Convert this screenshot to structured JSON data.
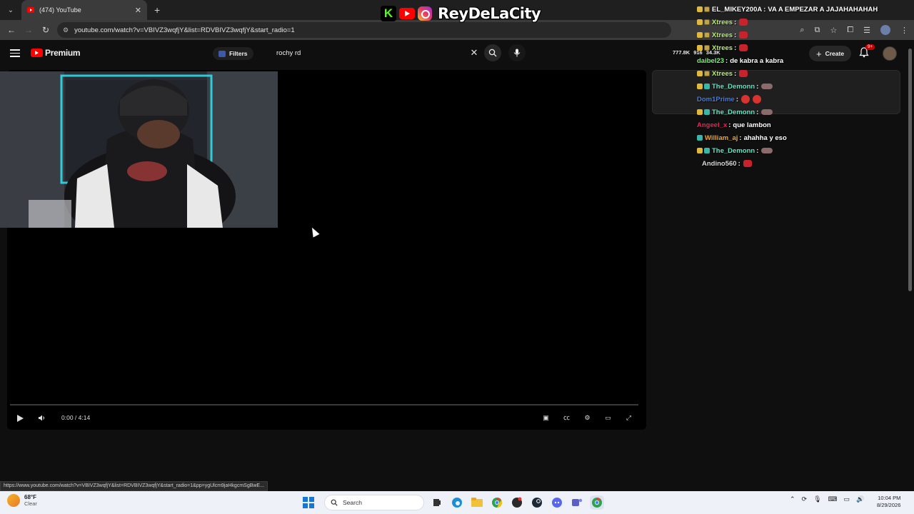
{
  "browser": {
    "tab_title": "(474) YouTube",
    "url": "youtube.com/watch?v=VBIVZ3wqfjY&list=RDVBIVZ3wqfjY&start_radio=1",
    "status_url": "https://www.youtube.com/watch?v=VBIVZ3wqfjY&list=RDVBIVZ3wqfjY&start_radio=1&pp=ygUlcm9jaHkgcmSgBwE..."
  },
  "overlay": {
    "streamer_name": "ReyDeLaCity",
    "colors": {
      "kick": "#53fc18",
      "youtube": "#ff0000"
    }
  },
  "youtube": {
    "logo_text": "Premium",
    "filters_label": "Filters",
    "search_value": "rochy rd",
    "stats": [
      "777.8K",
      "916",
      "34.3K"
    ],
    "create_label": "Create",
    "notif_badge": "9+"
  },
  "player": {
    "time": "0:00 / 4:14"
  },
  "chat": [
    {
      "user": "EL_MIKEY200A",
      "color": "#ffffff",
      "badges": [
        "crown",
        "sub"
      ],
      "text": "VA A EMPEZAR A JAJAHAHAHAH",
      "emotes": []
    },
    {
      "user": "Xtrees",
      "color": "#b8f06a",
      "badges": [
        "crown",
        "sub"
      ],
      "text": "",
      "emotes": [
        "heart"
      ]
    },
    {
      "user": "Xtrees",
      "color": "#b8f06a",
      "badges": [
        "crown",
        "sub"
      ],
      "text": "",
      "emotes": [
        "heart"
      ]
    },
    {
      "user": "Xtrees",
      "color": "#b8f06a",
      "badges": [
        "crown",
        "sub"
      ],
      "text": "",
      "emotes": [
        "heart"
      ]
    },
    {
      "user": "daibel23",
      "color": "#7ef07a",
      "badges": [],
      "text": "de kabra a kabra",
      "emotes": []
    },
    {
      "user": "Xtrees",
      "color": "#b8f06a",
      "badges": [
        "crown",
        "sub"
      ],
      "text": "",
      "emotes": [
        "heart"
      ]
    },
    {
      "user": "The_Demonn",
      "color": "#5ee7c4",
      "badges": [
        "crown",
        "tv"
      ],
      "text": "",
      "emotes": [
        "rat"
      ]
    },
    {
      "user": "Dom1Prime",
      "color": "#3c7fe8",
      "badges": [],
      "text": "",
      "emotes": [
        "devil",
        "devil"
      ]
    },
    {
      "user": "The_Demonn",
      "color": "#5ee7c4",
      "badges": [
        "crown",
        "tv"
      ],
      "text": "",
      "emotes": [
        "rat"
      ]
    },
    {
      "user": "Angeel_x",
      "color": "#e8265a",
      "badges": [],
      "text": "que lambon",
      "emotes": []
    },
    {
      "user": "William_aj",
      "color": "#e8a83a",
      "badges": [
        "tv"
      ],
      "text": "ahahha y eso",
      "emotes": []
    },
    {
      "user": "The_Demonn",
      "color": "#5ee7c4",
      "badges": [
        "crown",
        "tv"
      ],
      "text": "",
      "emotes": [
        "rat"
      ]
    },
    {
      "user": "Andino560",
      "color": "#d8d8d8",
      "badges": [],
      "text": "",
      "emotes": [
        "heart"
      ]
    }
  ],
  "taskbar": {
    "temp": "68°F",
    "condition": "Clear",
    "search_placeholder": "Search",
    "time": "10:04 PM",
    "date": "8/29/2026"
  }
}
